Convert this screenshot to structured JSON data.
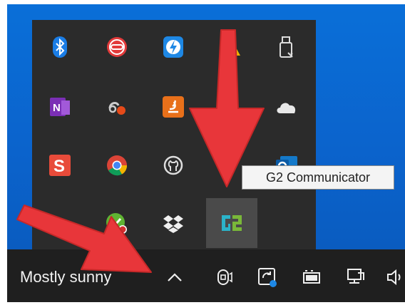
{
  "tooltip": {
    "text": "G2 Communicator"
  },
  "taskbar": {
    "weather": "Mostly sunny",
    "show_hidden_icons": "chevron-up-icon",
    "icons": [
      "meet-now-icon",
      "sync-status-icon",
      "battery-icon",
      "network-icon",
      "volume-icon"
    ]
  },
  "tray": {
    "icons": [
      [
        "bluetooth-icon",
        "red-circle-app-icon",
        "lightning-app-icon",
        "warning-app-icon",
        "usb-drive-icon"
      ],
      [
        "onenote-icon",
        "cloud-sync-notify-icon",
        "java-update-icon",
        "",
        "onedrive-cloud-icon"
      ],
      [
        "snagit-icon",
        "chrome-icon",
        "github-desktop-icon",
        "",
        "outlook-icon"
      ],
      [
        "dots-app-icon",
        "green-check-app-icon",
        "dropbox-icon",
        "g2-communicator-icon",
        ""
      ]
    ],
    "highlighted": "G2 Communicator"
  },
  "colors": {
    "desktop": "#0a6fd8",
    "popup": "#2b2b2b",
    "taskbar": "#1f1f1f",
    "arrow": "#e8363a"
  }
}
